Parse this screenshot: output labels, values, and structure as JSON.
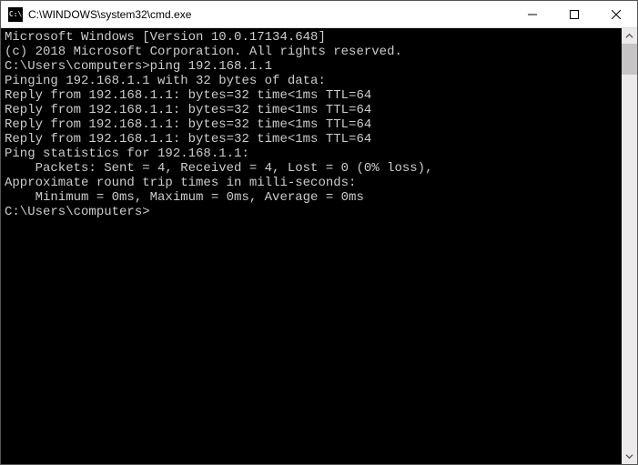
{
  "titlebar": {
    "icon_label": "C:\\",
    "title": "C:\\WINDOWS\\system32\\cmd.exe"
  },
  "console": {
    "line0": "Microsoft Windows [Version 10.0.17134.648]",
    "line1": "(c) 2018 Microsoft Corporation. All rights reserved.",
    "blank": "",
    "prompt1_prefix": "C:\\Users\\computers>",
    "prompt1_cmd": "ping 192.168.1.1",
    "ping_header": "Pinging 192.168.1.1 with 32 bytes of data:",
    "reply1": "Reply from 192.168.1.1: bytes=32 time<1ms TTL=64",
    "reply2": "Reply from 192.168.1.1: bytes=32 time<1ms TTL=64",
    "reply3": "Reply from 192.168.1.1: bytes=32 time<1ms TTL=64",
    "reply4": "Reply from 192.168.1.1: bytes=32 time<1ms TTL=64",
    "stats_header": "Ping statistics for 192.168.1.1:",
    "stats_packets": "    Packets: Sent = 4, Received = 4, Lost = 0 (0% loss),",
    "stats_rtt_header": "Approximate round trip times in milli-seconds:",
    "stats_rtt": "    Minimum = 0ms, Maximum = 0ms, Average = 0ms",
    "prompt2_prefix": "C:\\Users\\computers>"
  }
}
